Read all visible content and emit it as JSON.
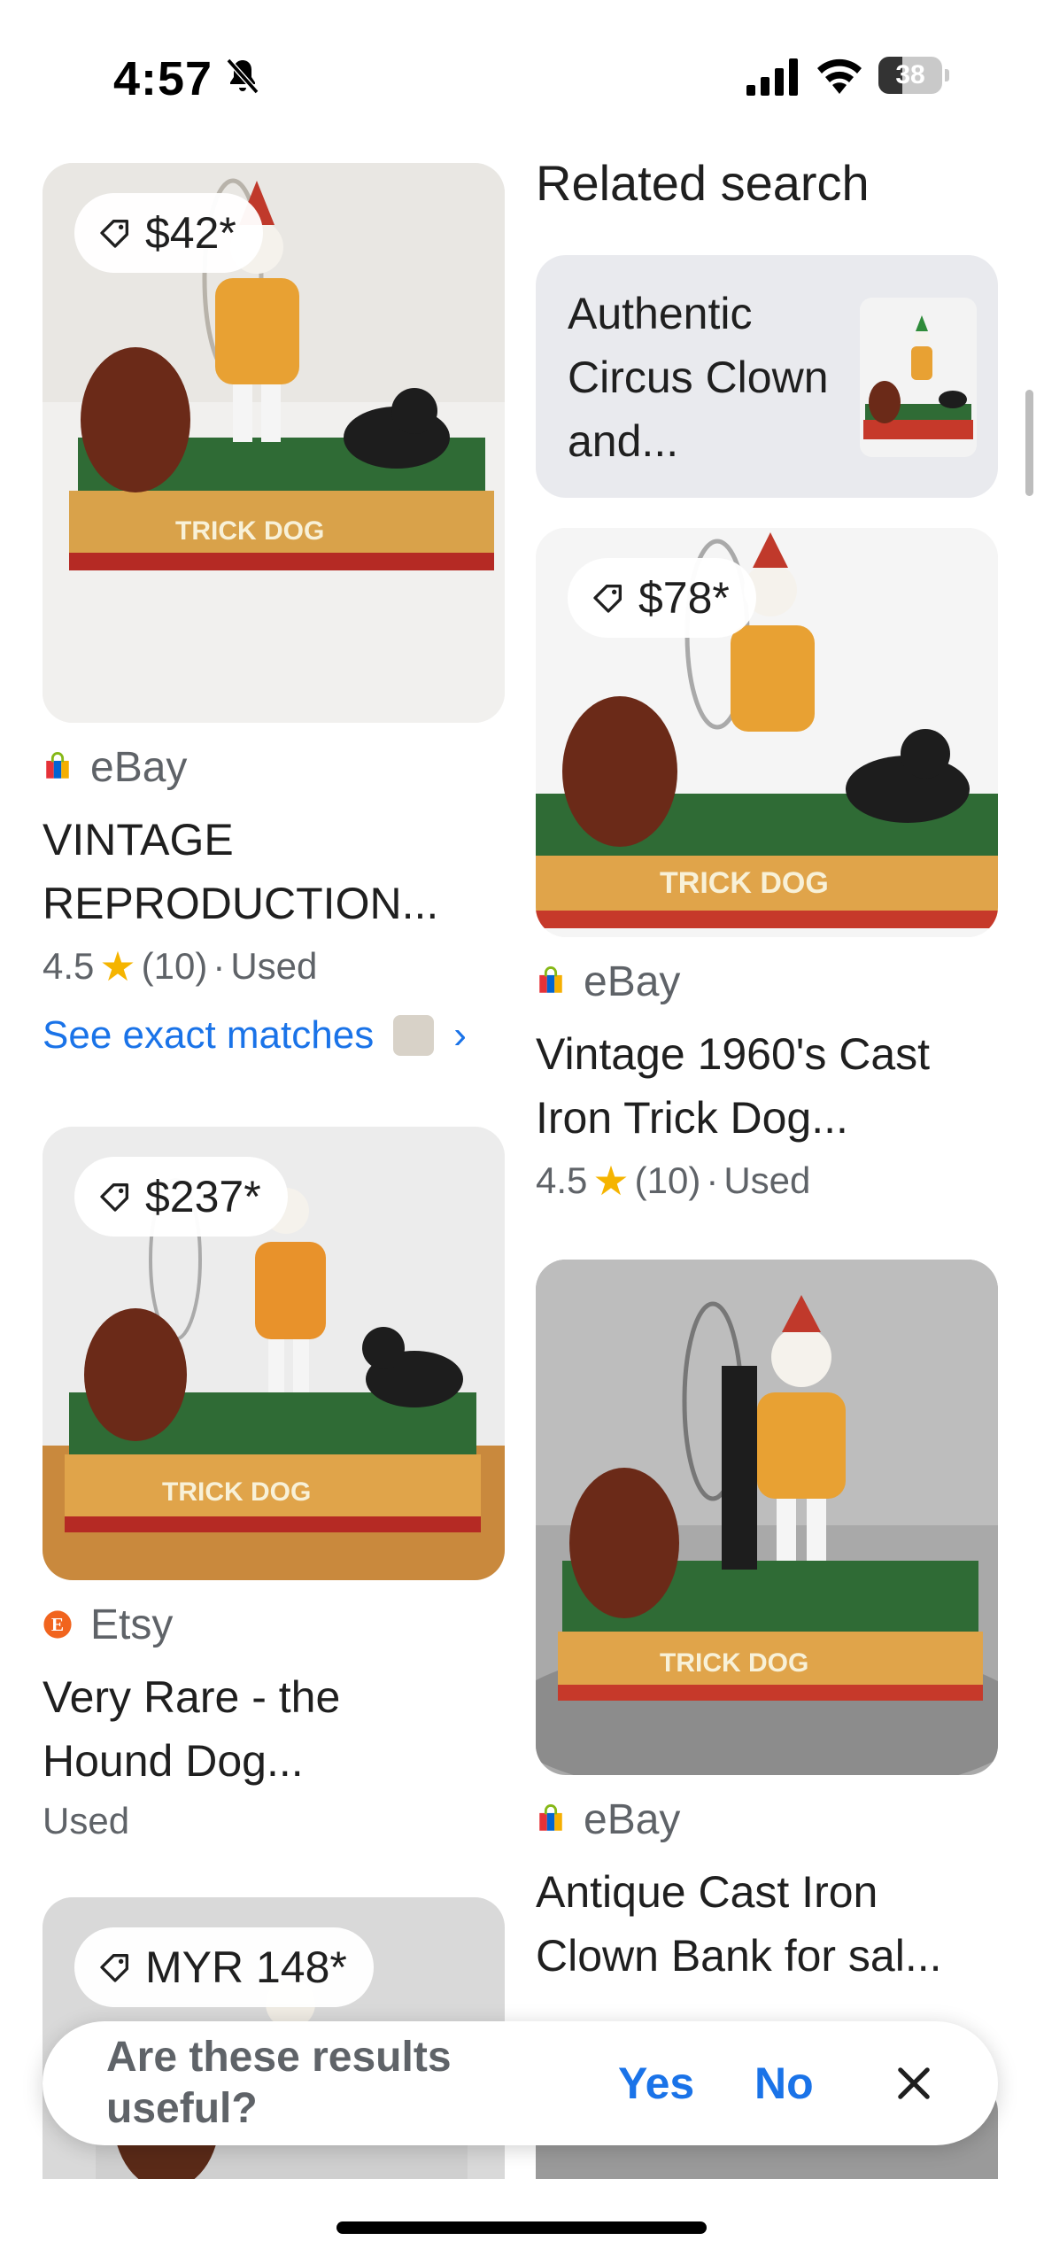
{
  "status_bar": {
    "time": "4:57",
    "battery": "38",
    "battery_level": 0.38,
    "icons": [
      "bell-off-icon",
      "signal-icon",
      "wifi-icon",
      "battery-icon"
    ]
  },
  "related": {
    "heading": "Related search",
    "item": {
      "label": "Authentic Circus Clown and..."
    }
  },
  "results_left": [
    {
      "price": "$42*",
      "source": "eBay",
      "title": "VINTAGE REPRODUCTION...",
      "rating": "4.5",
      "reviews": "(10)",
      "condition": "Used",
      "exact_matches_label": "See exact matches"
    },
    {
      "price": "$237*",
      "source": "Etsy",
      "title": "Very Rare - the Hound Dog...",
      "condition": "Used"
    },
    {
      "price": "MYR 148*"
    }
  ],
  "results_right": [
    {
      "price": "$78*",
      "source": "eBay",
      "title": "Vintage 1960's Cast Iron Trick Dog...",
      "rating": "4.5",
      "reviews": "(10)",
      "condition": "Used"
    },
    {
      "source": "eBay",
      "title": "Antique Cast Iron Clown Bank for sal..."
    }
  ],
  "feedback": {
    "question": "Are these results useful?",
    "yes": "Yes",
    "no": "No"
  },
  "colors": {
    "link_blue": "#1a73e8",
    "star_yellow": "#f5b400",
    "muted_text": "#5f6368",
    "etsy_orange": "#f1641e"
  }
}
